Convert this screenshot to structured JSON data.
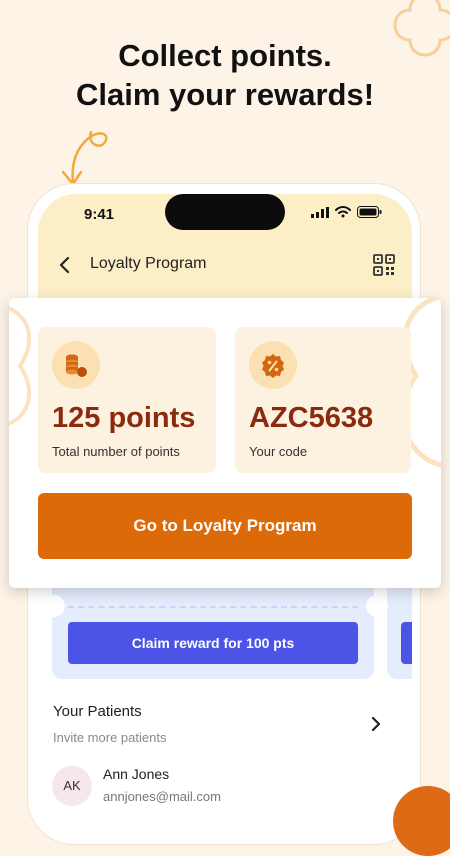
{
  "headline": {
    "line1": "Collect points.",
    "line2": "Claim your rewards!"
  },
  "status_bar": {
    "time": "9:41"
  },
  "nav": {
    "title": "Loyalty Program",
    "back_icon": "chevron-left-icon",
    "qr_icon": "qr-code-icon"
  },
  "loyalty_card": {
    "points_value": "125 points",
    "points_label": "Total number of points",
    "code_value": "AZC5638",
    "code_label": "Your code",
    "cta_label": "Go to Loyalty Program",
    "points_icon": "coins-icon",
    "code_icon": "discount-badge-icon"
  },
  "reward": {
    "claim_label": "Claim reward for 100 pts"
  },
  "patients": {
    "title": "Your Patients",
    "subtitle": "Invite more patients",
    "items": [
      {
        "initials": "AK",
        "name": "Ann Jones",
        "email": "annjones@mail.com"
      }
    ]
  },
  "colors": {
    "background": "#fdf3e7",
    "accent": "#dd6a08",
    "points_text": "#8a2a0e",
    "claim_button": "#4b54e6",
    "header_yellow": "#fcefc7"
  }
}
